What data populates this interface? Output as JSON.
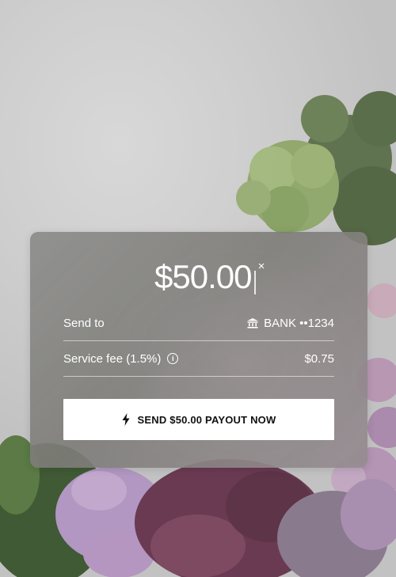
{
  "payout": {
    "amount": "$50.00",
    "clear_icon": "×"
  },
  "rows": {
    "send_to_label": "Send to",
    "send_to_value": "BANK ••1234",
    "fee_label": "Service fee (1.5%)",
    "fee_value": "$0.75"
  },
  "cta": {
    "label": "SEND $50.00 PAYOUT NOW"
  },
  "icons": {
    "bank": "bank-icon",
    "info": "info-icon",
    "bolt": "lightning-bolt-icon",
    "clear": "close-icon"
  },
  "colors": {
    "card_glass": "#8a8a87",
    "button_bg": "#ffffff",
    "button_text": "#111111",
    "text_on_glass": "#ffffff"
  }
}
